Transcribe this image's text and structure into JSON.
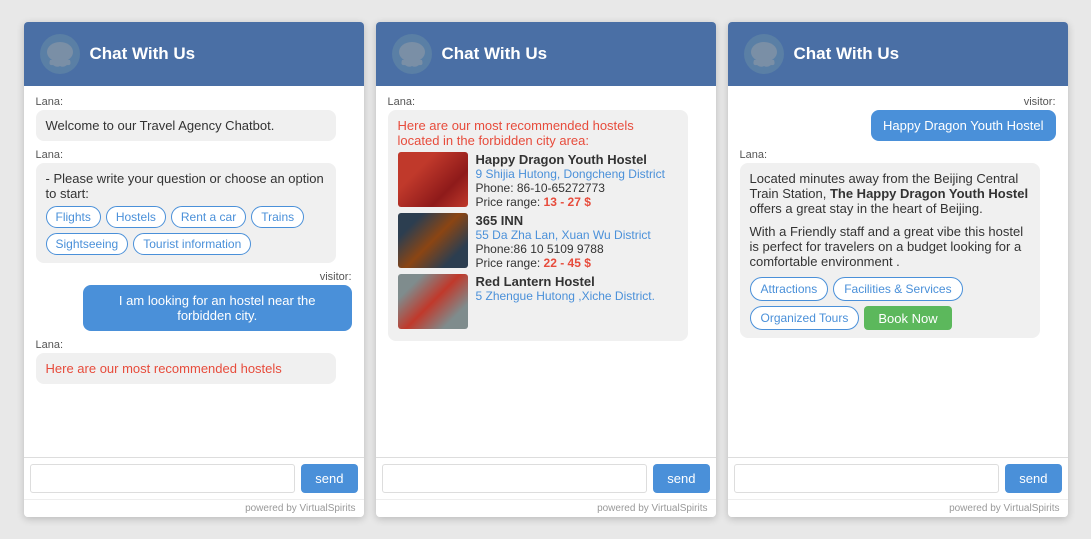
{
  "header": {
    "title": "Chat With Us",
    "avatar_icon": "💬"
  },
  "panel1": {
    "lana_label": "Lana:",
    "welcome_msg": "Welcome to our Travel Agency Chatbot.",
    "lana_label2": "Lana:",
    "prompt_msg": "- Please write your question or choose an option to start:",
    "buttons": [
      "Flights",
      "Hostels",
      "Rent a car",
      "Trains",
      "Sightseeing",
      "Tourist information"
    ],
    "visitor_label": "visitor:",
    "visitor_msg": "I am looking for an hostel near the forbidden city.",
    "lana_label3": "Lana:",
    "partial_msg": "Here are our most recommended hostels",
    "send_label": "send",
    "powered": "powered by VirtualSpirits"
  },
  "panel2": {
    "lana_label": "Lana:",
    "intro_text": "Here are our most recommended hostels located in the forbidden city area:",
    "hostels": [
      {
        "name": "Happy Dragon Youth Hostel",
        "address": "9 Shijia Hutong, Dongcheng District",
        "phone": "Phone: 86-10-65272773",
        "price_label": "Price range:",
        "price_range": "13 - 27 $",
        "img_class": "hostel-img-1"
      },
      {
        "name": "365 INN",
        "address": "55 Da Zha Lan, Xuan Wu District",
        "phone": "Phone:86 10 5109 9788",
        "price_label": "Price range:",
        "price_range": "22 - 45 $",
        "img_class": "hostel-img-2"
      },
      {
        "name": "Red Lantern Hostel",
        "address": "5 Zhengue Hutong ,Xiche District.",
        "phone": "",
        "price_label": "",
        "price_range": "",
        "img_class": "hostel-img-3"
      }
    ],
    "send_label": "send",
    "powered": "powered by VirtualSpirits"
  },
  "panel3": {
    "visitor_label": "visitor:",
    "visitor_msg": "Happy Dragon Youth Hostel",
    "lana_label": "Lana:",
    "description_p1": "Located minutes away from the Beijing Central Train Station, ",
    "bold_text": "The Happy Dragon Youth Hostel",
    "description_p2": " offers a great stay in the heart of Beijing.",
    "description_p3": "With a Friendly staff and a great vibe this hostel is perfect for travelers on a budget looking for a comfortable environment .",
    "action_buttons": [
      "Attractions",
      "Facilities & Services",
      "Organized Tours"
    ],
    "book_now_label": "Book Now",
    "send_label": "send",
    "powered": "powered by VirtualSpirits"
  }
}
